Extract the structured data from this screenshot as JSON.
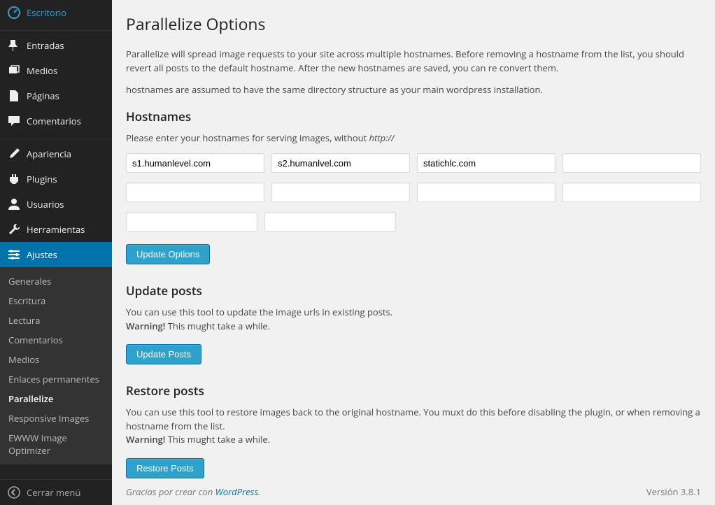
{
  "sidebar": {
    "items": [
      {
        "label": "Escritorio"
      },
      {
        "label": "Entradas"
      },
      {
        "label": "Medios"
      },
      {
        "label": "Páginas"
      },
      {
        "label": "Comentarios"
      },
      {
        "label": "Apariencia"
      },
      {
        "label": "Plugins"
      },
      {
        "label": "Usuarios"
      },
      {
        "label": "Herramientas"
      },
      {
        "label": "Ajustes"
      }
    ],
    "submenu": [
      {
        "label": "Generales"
      },
      {
        "label": "Escritura"
      },
      {
        "label": "Lectura"
      },
      {
        "label": "Comentarios"
      },
      {
        "label": "Medios"
      },
      {
        "label": "Enlaces permanentes"
      },
      {
        "label": "Parallelize"
      },
      {
        "label": "Responsive Images"
      },
      {
        "label": "EWWW Image Optimizer"
      }
    ],
    "collapse": "Cerrar menú"
  },
  "page": {
    "title": "Parallelize Options",
    "intro1": "Parallelize will spread image requests to your site across multiple hostnames. Before removing a hostname from the list, you should revert all posts to the default hostname. After the new hostnames are saved, you can re convert them.",
    "intro2": "hostnames are assumed to have the same directory structure as your main wordpress installation.",
    "hostnames_heading": "Hostnames",
    "hostnames_hint_pre": "Please enter your hostnames for serving images, without ",
    "hostnames_hint_em": "http://",
    "hostnames": [
      "s1.humanlevel.com",
      "s2.humanlvel.com",
      "statichlc.com",
      "",
      "",
      "",
      "",
      "",
      "",
      ""
    ],
    "btn_update_options": "Update Options",
    "update_heading": "Update posts",
    "update_text": "You can use this tool to update the image urls in existing posts.",
    "warning_label": "Warning!",
    "warning_text": " This mught take a while.",
    "btn_update_posts": "Update Posts",
    "restore_heading": "Restore posts",
    "restore_text": "You can use this tool to restore images back to the original hostname. You muxt do this before disabling the plugin, or when removing a hostname from the list.",
    "btn_restore_posts": "Restore Posts"
  },
  "footer": {
    "thanks_pre": "Gracias por crear con ",
    "thanks_link": "WordPress.",
    "version": "Versión 3.8.1"
  }
}
